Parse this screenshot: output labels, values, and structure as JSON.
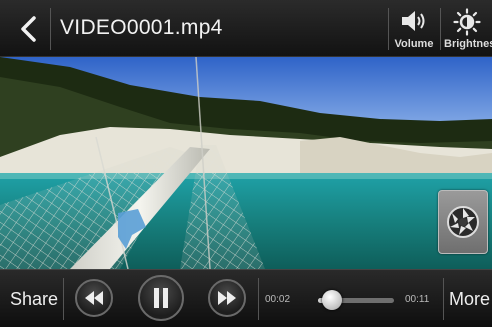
{
  "header": {
    "title": "VIDEO0001.mp4",
    "volume_label": "Volume",
    "brightness_label": "Brightness",
    "icons": [
      "back-arrow-icon",
      "volume-icon",
      "brightness-icon"
    ]
  },
  "player": {
    "elapsed": "00:02",
    "duration": "00:11",
    "progress": 0.18,
    "state": "playing"
  },
  "controls": {
    "share_label": "Share",
    "more_label": "More",
    "icons": [
      "rewind-icon",
      "pause-icon",
      "fast-forward-icon",
      "camera-shutter-icon"
    ]
  }
}
